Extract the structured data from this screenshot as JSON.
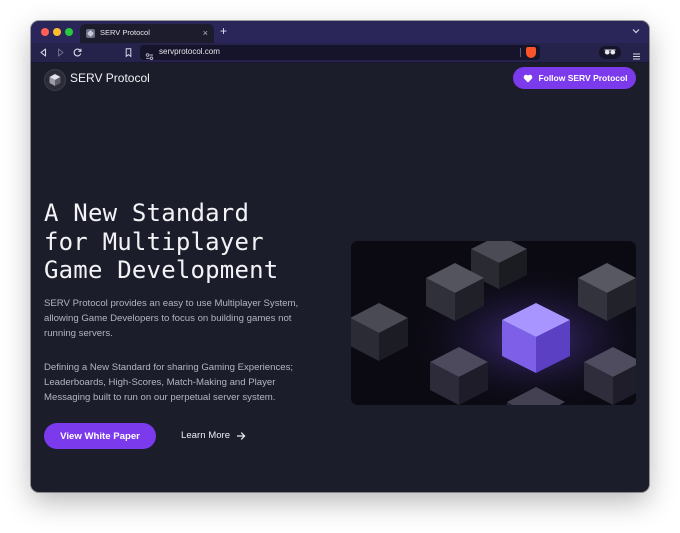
{
  "browser": {
    "tab_title": "SERV Protocol",
    "tab_close": "×",
    "new_tab": "+",
    "url": "servprotocol.com"
  },
  "header": {
    "brand": "SERV Protocol",
    "follow_label": "Follow SERV Protocol"
  },
  "hero": {
    "title_lines": [
      "A New Standard",
      "for Multiplayer",
      "Game Development"
    ],
    "paragraph1_lines": [
      "SERV Protocol provides an easy to use Multiplayer System,",
      "allowing Game Developers to focus on building games not",
      "running servers."
    ],
    "paragraph2_lines": [
      "Defining a New Standard for sharing Gaming Experiences;",
      "Leaderboards, High-Scores, Match-Making and Player",
      "Messaging built to run on our perpetual server system."
    ],
    "primary_button": "View White Paper",
    "secondary_link": "Learn More"
  },
  "colors": {
    "page_background": "#1c1d2a",
    "accent": "#7c3aed",
    "tab_strip": "#2a2659"
  },
  "icons": {
    "tab_favicon": "serv-logo-icon",
    "follow": "heart-icon",
    "learn_more": "arrow-right-icon",
    "extension": "sunglasses-icon",
    "menu": "hamburger-icon"
  }
}
